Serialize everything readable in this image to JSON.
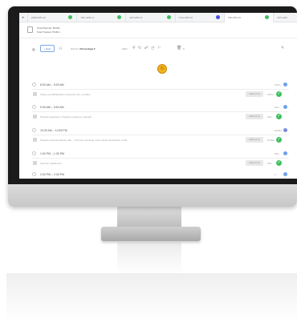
{
  "tabs": [
    {
      "label": "WED APR 10",
      "dot": "#3fbf60",
      "active": false
    },
    {
      "label": "THU APR 11",
      "dot": "#3fbf60",
      "active": false
    },
    {
      "label": "FRI APR 12",
      "dot": "#3fbf60",
      "active": false
    },
    {
      "label": "THU APR 16",
      "dot": "#4a4fd8",
      "active": false
    },
    {
      "label": "FRI APR 15",
      "dot": "#3fbf60",
      "active": true
    },
    {
      "label": "SAT APR",
      "dot": "",
      "active": false
    }
  ],
  "header": {
    "line1": "Total Planned: 8h00m",
    "line2": "Total Tracked: 5h30m"
  },
  "toolbar": {
    "new_label": "+ New",
    "sort_prefix": "Sort by:",
    "sort_value": "Chronology ▾",
    "filter_label": "Filter:",
    "filter_icons": "⚲ ↻ ☍ ◷ ⚐",
    "trash_count": "0"
  },
  "icons": {
    "tab_home": "▸",
    "grid": "▦",
    "users": "⚇",
    "trash": "🗑",
    "edit": "✎",
    "emoji": "☺",
    "check": "✓"
  },
  "blocks": [
    {
      "time": "8:00 AM – 9:30 AM",
      "duration": "1h5m",
      "dot": "#6ea0f0",
      "task": {
        "text": "Study new Mobilization tutorial for the .one Box",
        "tag": "Admin (1:1)",
        "duration": "1h5m"
      }
    },
    {
      "time": "9:30 AM – 9:50 AM",
      "duration": "20m",
      "dot": "#6ea0f0",
      "task": {
        "text": "Prepare appetizers, Prepare employee outreach",
        "tag": "Admin (1:1)",
        "duration": "20m"
      }
    },
    {
      "time": "10:30 AM – 12:59 PM",
      "duration": "2h30m",
      "dot": "#7b8be0",
      "task": {
        "text": "Prepare correspondence with .. info from meetings, limit outputs and advice of Ms",
        "tag": "Admin (1:1)",
        "duration": "2h30m"
      }
    },
    {
      "time": "1:00 PM – 1:30 PM",
      "duration": "30m",
      "dot": "#6ea0f0",
      "task": {
        "text": "Send for distribution",
        "tag": "Admin (1:1)",
        "duration": "30m"
      }
    },
    {
      "time": "2:00 PM – 2:30 PM",
      "duration": "0",
      "dot": "#6ea0f0",
      "task": null
    }
  ]
}
